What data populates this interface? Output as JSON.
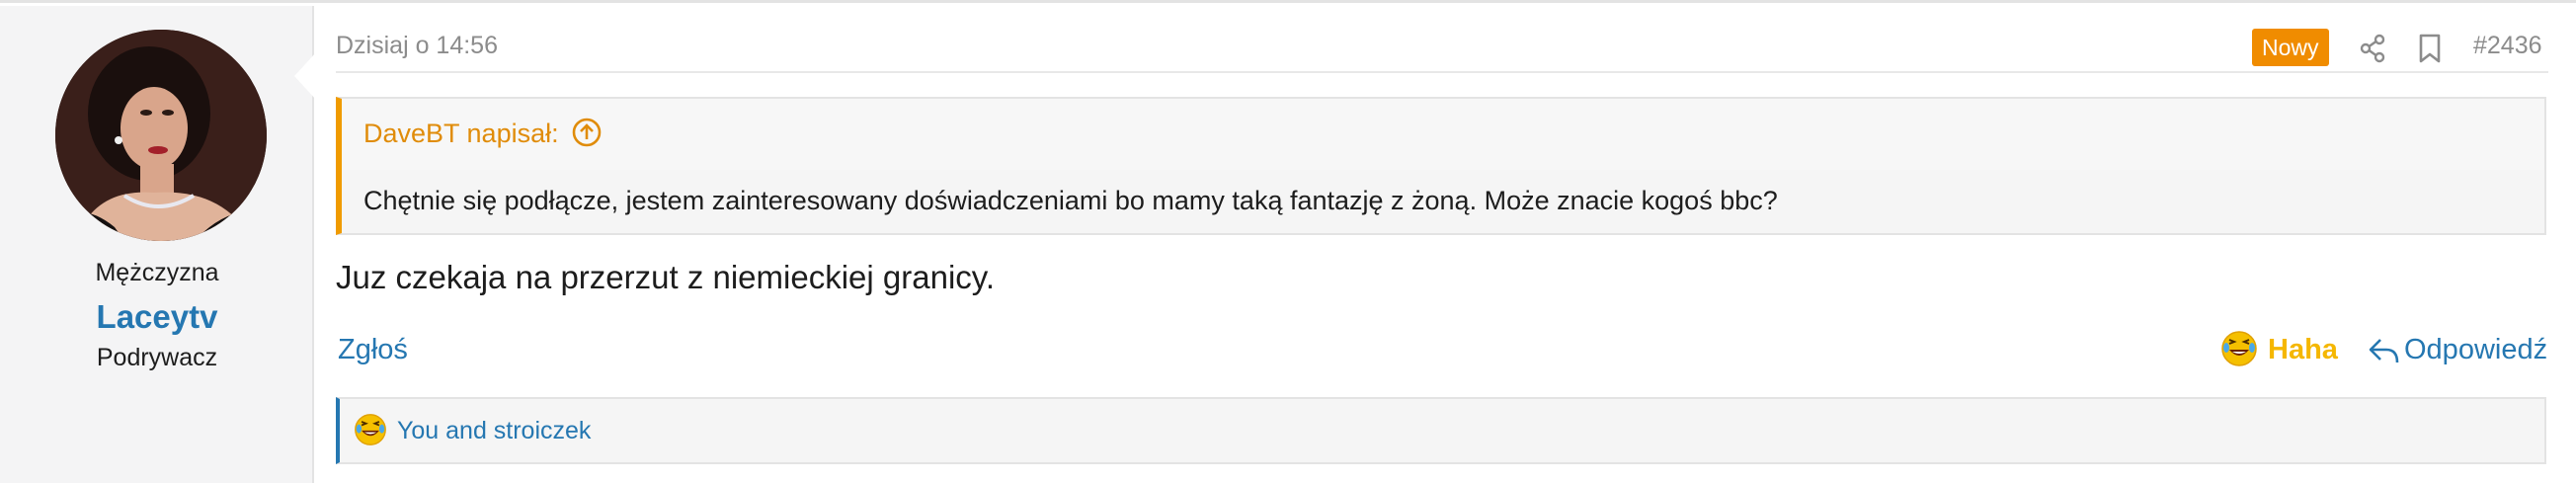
{
  "user": {
    "gender": "Mężczyzna",
    "username": "Laceytv",
    "rank": "Podrywacz"
  },
  "post": {
    "date": "Dzisiaj o 14:56",
    "badge": "Nowy",
    "number": "#2436",
    "quote": {
      "author": "DaveBT napisał:",
      "body": "Chętnie się podłącze, jestem zainteresowany doświadczeniami bo mamy taką fantazję z żoną. Może znacie kogoś bbc?"
    },
    "message": "Juz czekaja na przerzut z niemieckiej granicy."
  },
  "actions": {
    "report": "Zgłoś",
    "reaction": "Haha",
    "reply": "Odpowiedź"
  },
  "reactions": {
    "summary": "You and stroiczek"
  },
  "icons": {
    "share": "share-icon",
    "bookmark": "bookmark-icon",
    "quote_up": "arrow-up-circle-icon",
    "reply": "reply-icon",
    "haha": "laughing-emoji-icon"
  },
  "colors": {
    "accent": "#2577b1",
    "new_badge": "#f08c00",
    "quote_border": "#f09b00",
    "haha": "#f5b700"
  }
}
